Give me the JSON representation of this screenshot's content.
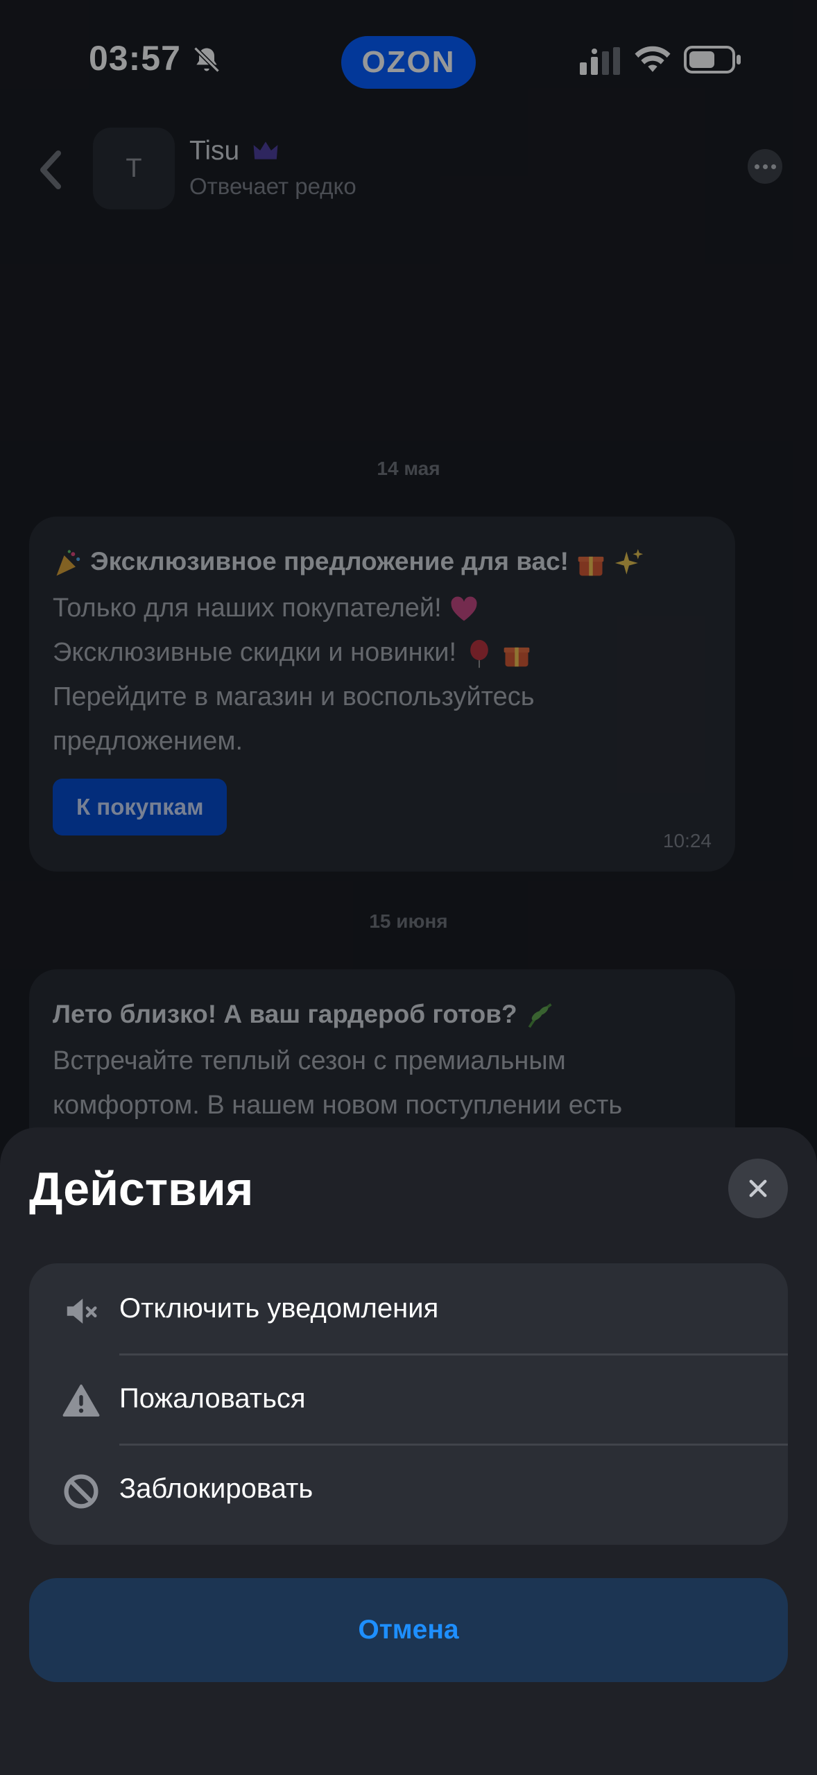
{
  "status_bar": {
    "time": "03:57",
    "brand": "OZON"
  },
  "chat": {
    "contact_initial": "T",
    "contact_name": "Tisu",
    "contact_status": "Отвечает редко"
  },
  "messages": [
    {
      "date": "14 мая",
      "title": "Эксклюзивное предложение для вас!",
      "lines": [
        "Только для наших покупателей!",
        "Эксклюзивные скидки и новинки!",
        "Перейдите в магазин и воспользуйтесь",
        "предложением."
      ],
      "button_label": "К покупкам",
      "time": "10:24"
    },
    {
      "date": "15 июня",
      "title": "Лето близко! А ваш гардероб готов?",
      "lines": [
        "Встречайте теплый сезон с премиальным",
        "комфортом. В нашем новом поступлении есть"
      ]
    }
  ],
  "sheet": {
    "title": "Действия",
    "actions": [
      {
        "label": "Отключить уведомления",
        "icon": "mute-icon"
      },
      {
        "label": "Пожаловаться",
        "icon": "warning-icon"
      },
      {
        "label": "Заблокировать",
        "icon": "block-icon"
      }
    ],
    "cancel_label": "Отмена"
  },
  "colors": {
    "background": "#15171c",
    "sheet": "#1f2127",
    "ozon_blue": "#005bff",
    "cancel_text": "#1e8fff"
  }
}
